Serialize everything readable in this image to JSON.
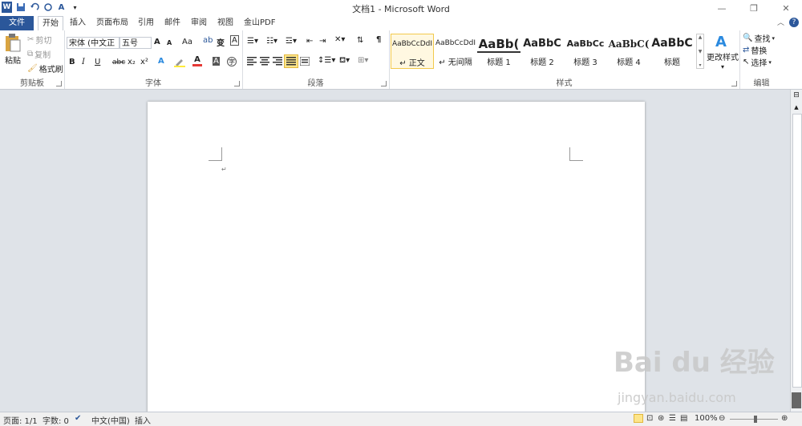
{
  "window": {
    "title": "文档1 - Microsoft Word",
    "app_icon": "W"
  },
  "qat": [
    "word-app-icon",
    "save-icon",
    "undo-icon",
    "redo-icon",
    "format-icon",
    "customize-icon"
  ],
  "tabs": [
    {
      "label": "文件"
    },
    {
      "label": "开始"
    },
    {
      "label": "插入"
    },
    {
      "label": "页面布局"
    },
    {
      "label": "引用"
    },
    {
      "label": "邮件"
    },
    {
      "label": "审阅"
    },
    {
      "label": "视图"
    },
    {
      "label": "金山PDF"
    }
  ],
  "clipboard": {
    "paste": "粘贴",
    "cut": "剪切",
    "copy": "复制",
    "format_painter": "格式刷",
    "group": "剪贴板"
  },
  "font": {
    "font_name": "宋体 (中文正文",
    "font_size": "五号",
    "grow": "A",
    "shrink": "A",
    "case": "Aa",
    "bold": "B",
    "italic": "I",
    "underline": "U",
    "strike": "abc",
    "sub": "x₂",
    "sup": "x²",
    "group": "字体"
  },
  "paragraph": {
    "group": "段落"
  },
  "styles": {
    "items": [
      {
        "sample": "AaBbCcDdI",
        "name": "↵ 正文"
      },
      {
        "sample": "AaBbCcDdI",
        "name": "↵ 无间隔"
      },
      {
        "sample": "AaBb(",
        "name": "标题 1"
      },
      {
        "sample": "AaBbC",
        "name": "标题 2"
      },
      {
        "sample": "AaBbCc",
        "name": "标题 3"
      },
      {
        "sample": "AaBbC(",
        "name": "标题 4"
      },
      {
        "sample": "AaBbC",
        "name": "标题"
      }
    ],
    "change": "更改样式",
    "group": "样式"
  },
  "editing": {
    "find": "查找",
    "replace": "替换",
    "select": "选择",
    "group": "编辑"
  },
  "status": {
    "page": "页面: 1/1",
    "words": "字数: 0",
    "language": "中文(中国)",
    "mode": "插入",
    "zoom": "100%"
  },
  "watermark": {
    "brand": "Bai du 经验",
    "url": "jingyan.baidu.com"
  },
  "colors": {
    "file_tab": "#2b579a",
    "accent": "#2b579a",
    "active_style_border": "#f2c94c"
  }
}
